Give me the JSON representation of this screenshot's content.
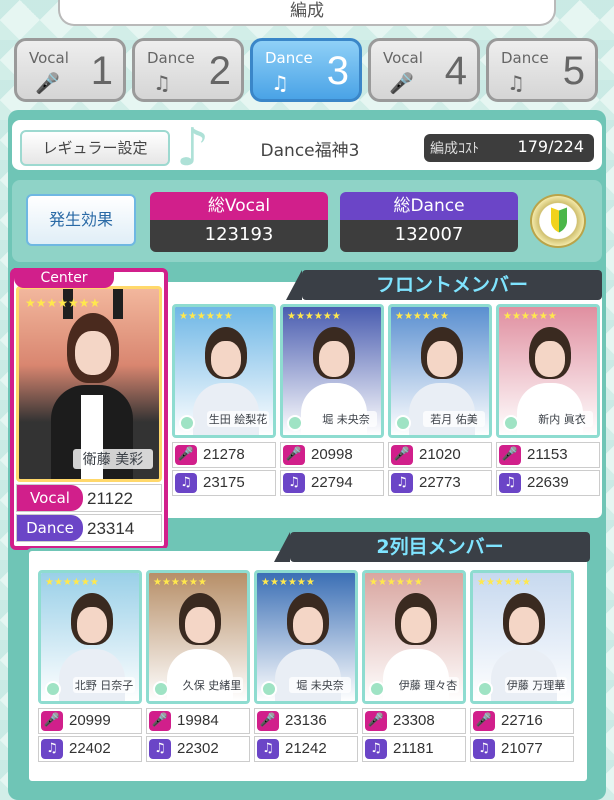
{
  "header": {
    "title": "編成"
  },
  "tabs": [
    {
      "kind": "Vocal",
      "number": "1",
      "icon": "microphone-icon",
      "active": false
    },
    {
      "kind": "Dance",
      "number": "2",
      "icon": "music-note-icon",
      "active": false
    },
    {
      "kind": "Dance",
      "number": "3",
      "icon": "music-note-icon",
      "active": true
    },
    {
      "kind": "Vocal",
      "number": "4",
      "icon": "microphone-icon",
      "active": false
    },
    {
      "kind": "Dance",
      "number": "5",
      "icon": "music-note-icon",
      "active": false
    }
  ],
  "deck": {
    "regular_button": "レギュラー設定",
    "name": "Dance福神3",
    "cost_label": "編成ｺｽﾄ",
    "cost_value": "179/224"
  },
  "stats": {
    "effect_button": "発生効果",
    "vocal_label": "総Vocal",
    "vocal_value": "123193",
    "dance_label": "総Dance",
    "dance_value": "132007"
  },
  "center": {
    "tag": "Center",
    "name": "衛藤 美彩",
    "vocal_label": "Vocal",
    "vocal": "21122",
    "dance_label": "Dance",
    "dance": "23314"
  },
  "front": {
    "title": "フロントメンバー",
    "members": [
      {
        "name": "生田 絵梨花",
        "vocal": "21278",
        "dance": "23175"
      },
      {
        "name": "堀 未央奈",
        "vocal": "20998",
        "dance": "22794"
      },
      {
        "name": "若月 佑美",
        "vocal": "21020",
        "dance": "22773"
      },
      {
        "name": "新内 眞衣",
        "vocal": "21153",
        "dance": "22639"
      }
    ]
  },
  "second": {
    "title": "2列目メンバー",
    "members": [
      {
        "name": "北野 日奈子",
        "vocal": "20999",
        "dance": "22402"
      },
      {
        "name": "久保 史緒里",
        "vocal": "19984",
        "dance": "22302"
      },
      {
        "name": "堀 未央奈",
        "vocal": "23136",
        "dance": "21242"
      },
      {
        "name": "伊藤 理々杏",
        "vocal": "23308",
        "dance": "21181"
      },
      {
        "name": "伊藤 万理華",
        "vocal": "22716",
        "dance": "21077"
      }
    ]
  },
  "colors": {
    "accent": "#6fc5b6",
    "vocal": "#d11f8b",
    "dance": "#6b45c7",
    "active_tab": "#4aa3e6"
  }
}
